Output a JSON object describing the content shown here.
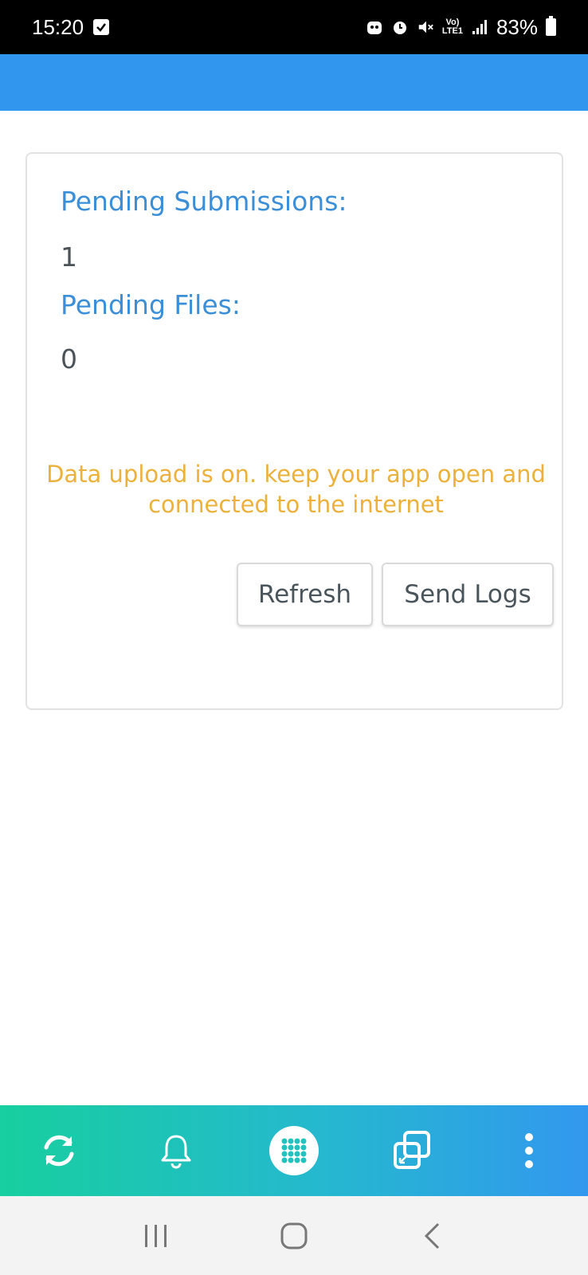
{
  "status_bar": {
    "time": "15:20",
    "network_label_top": "Vo)",
    "network_label_bottom": "LTE1",
    "battery": "83%"
  },
  "card": {
    "pending_submissions_label": "Pending Submissions:",
    "pending_submissions_value": "1",
    "pending_files_label": "Pending Files:",
    "pending_files_value": "0",
    "message": "Data upload is on. keep your app open and connected to the internet",
    "refresh_label": "Refresh",
    "send_logs_label": "Send Logs"
  },
  "colors": {
    "header": "#3196ee",
    "label": "#3a8fd8",
    "warning": "#ebb13a",
    "nav_start": "#17cf9f",
    "nav_end": "#3298ee"
  },
  "bottom_nav": {
    "items": [
      "sync-icon",
      "bell-icon",
      "apps-grid-icon",
      "windows-icon",
      "more-vertical-icon"
    ]
  }
}
